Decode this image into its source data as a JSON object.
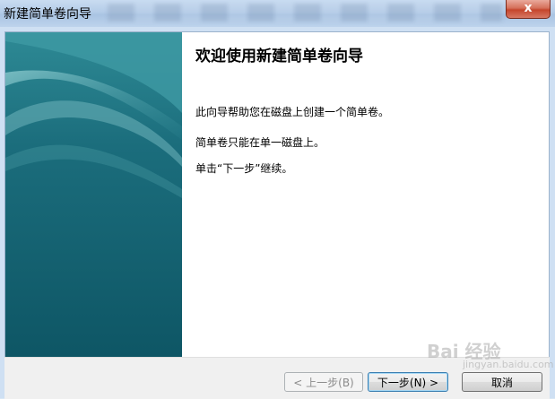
{
  "window": {
    "title": "新建简单卷向导",
    "close_glyph": "x"
  },
  "wizard": {
    "heading": "欢迎使用新建简单卷向导",
    "paragraphs": [
      "此向导帮助您在磁盘上创建一个简单卷。",
      "简单卷只能在单一磁盘上。",
      "单击“下一步”继续。"
    ]
  },
  "buttons": {
    "back": "< 上一步(B)",
    "next": "下一步(N) >",
    "cancel": "取消"
  },
  "watermark": {
    "text": "Bai 经验",
    "sub": "jingyan.baidu.com"
  },
  "colors": {
    "side_panel_dark": "#0e5a6a",
    "side_panel_light": "#3b8f9e",
    "title_bar": "#b4cce8",
    "close_button": "#c5452c"
  }
}
